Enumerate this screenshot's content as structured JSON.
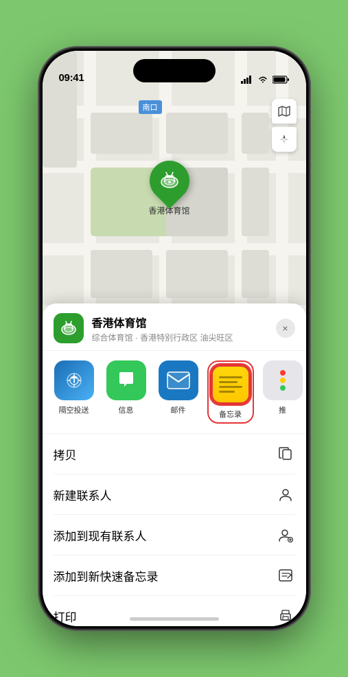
{
  "status_bar": {
    "time": "09:41",
    "location_icon": "▶",
    "signal": "●●●●",
    "wifi": "wifi",
    "battery": "battery"
  },
  "map": {
    "label_text": "南口",
    "pin_label": "香港体育馆",
    "controls": {
      "map_icon": "map",
      "location_icon": "location"
    }
  },
  "venue_card": {
    "name": "香港体育馆",
    "description": "综合体育馆 · 香港特别行政区 油尖旺区",
    "close_label": "×"
  },
  "apps": [
    {
      "id": "airdrop",
      "label": "隔空投送",
      "type": "airdrop"
    },
    {
      "id": "messages",
      "label": "信息",
      "type": "messages"
    },
    {
      "id": "mail",
      "label": "邮件",
      "type": "mail"
    },
    {
      "id": "notes",
      "label": "备忘录",
      "type": "notes"
    },
    {
      "id": "more",
      "label": "推",
      "type": "more"
    }
  ],
  "actions": [
    {
      "label": "拷贝",
      "icon": "copy"
    },
    {
      "label": "新建联系人",
      "icon": "person"
    },
    {
      "label": "添加到现有联系人",
      "icon": "person-add"
    },
    {
      "label": "添加到新快速备忘录",
      "icon": "note"
    },
    {
      "label": "打印",
      "icon": "print"
    }
  ]
}
